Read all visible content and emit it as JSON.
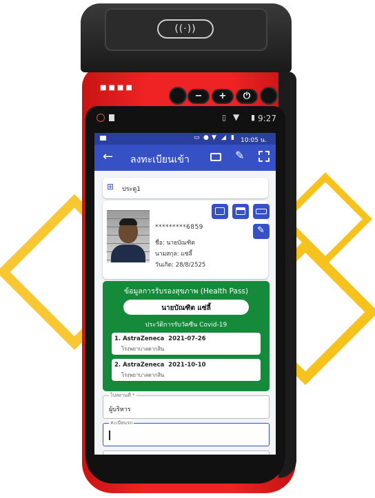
{
  "nfc_symbol": "((·))",
  "outer_status": {
    "time": "9:27"
  },
  "screen_status": {
    "time": "10:05 น."
  },
  "appbar": {
    "title": "ลงทะเบียนเข้า"
  },
  "gate": {
    "label": "ประตู1"
  },
  "person": {
    "id_masked": "*********6859",
    "name": "ชื่อ: นายบัณฑิต",
    "surname": "นามสกุล: แซ่ลี้",
    "birthdate": "วันเกิด: 28/8/2525"
  },
  "health_pass": {
    "title": "ข้อมูลการรับรองสุขภาพ (Health Pass)",
    "person_name": "นายบัณฑิต แซ่ลี้",
    "history_title": "ประวัติการรับวัคซีน Covid-19",
    "vaccines": [
      {
        "entry": "1. AstraZeneca  2021-07-26",
        "place": "โรงพยาบาลตากสิน"
      },
      {
        "entry": "2. AstraZeneca  2021-10-10",
        "place": "โรงพยาบาลตากสิน"
      }
    ]
  },
  "form": {
    "job_label": "ไปสถานที่ *",
    "job_value": "ผู้บริหาร",
    "plate_label": "ทะเบียนรถ"
  },
  "colors": {
    "primary": "#3651c6",
    "green": "#148a3a",
    "device_red": "#ef2323",
    "accent_yellow": "#f2b705"
  }
}
